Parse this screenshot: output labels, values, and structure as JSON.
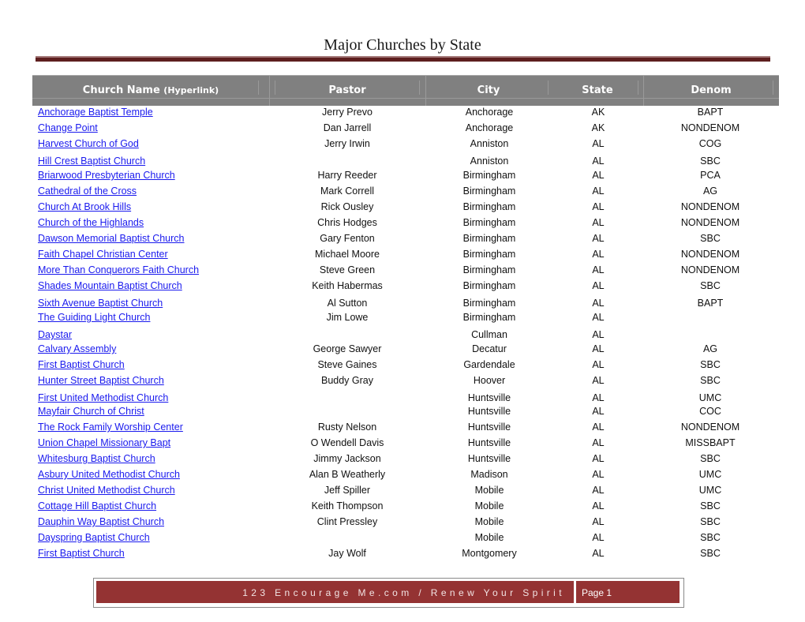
{
  "document": {
    "title": "Major Churches by State"
  },
  "table": {
    "headers": {
      "church_name": "Church Name",
      "church_name_note": "(Hyperlink)",
      "pastor": "Pastor",
      "city": "City",
      "state": "State",
      "denom": "Denom"
    },
    "rows": [
      {
        "name": "Anchorage Baptist Temple",
        "pastor": "Jerry Prevo",
        "city": "Anchorage",
        "state": "AK",
        "denom": "BAPT"
      },
      {
        "name": "Change Point",
        "pastor": "Dan Jarrell",
        "city": "Anchorage",
        "state": "AK",
        "denom": "NONDENOM"
      },
      {
        "name": "Harvest Church of God",
        "pastor": "Jerry Irwin",
        "city": "Anniston",
        "state": "AL",
        "denom": "COG"
      },
      {
        "name": "Hill Crest Baptist Church",
        "pastor": "",
        "city": "Anniston",
        "state": "AL",
        "denom": "SBC"
      },
      {
        "name": "Briarwood Presbyterian Church",
        "pastor": "Harry Reeder",
        "city": "Birmingham",
        "state": "AL",
        "denom": "PCA"
      },
      {
        "name": "Cathedral of the Cross",
        "pastor": "Mark Correll",
        "city": "Birmingham",
        "state": "AL",
        "denom": "AG"
      },
      {
        "name": "Church At Brook Hills",
        "pastor": "Rick Ousley",
        "city": "Birmingham",
        "state": "AL",
        "denom": "NONDENOM"
      },
      {
        "name": "Church of the Highlands",
        "pastor": "Chris Hodges",
        "city": "Birmingham",
        "state": "AL",
        "denom": "NONDENOM"
      },
      {
        "name": "Dawson Memorial Baptist Church",
        "pastor": "Gary Fenton",
        "city": "Birmingham",
        "state": "AL",
        "denom": "SBC"
      },
      {
        "name": "Faith Chapel Christian Center",
        "pastor": "Michael Moore",
        "city": "Birmingham",
        "state": "AL",
        "denom": "NONDENOM"
      },
      {
        "name": "More Than Conquerors Faith Church",
        "pastor": "Steve Green",
        "city": "Birmingham",
        "state": "AL",
        "denom": "NONDENOM"
      },
      {
        "name": "Shades Mountain Baptist Church",
        "pastor": "Keith Habermas",
        "city": "Birmingham",
        "state": "AL",
        "denom": "SBC"
      },
      {
        "name": "Sixth Avenue Baptist Church",
        "pastor": "Al Sutton",
        "city": "Birmingham",
        "state": "AL",
        "denom": "BAPT"
      },
      {
        "name": "The Guiding Light Church",
        "pastor": "Jim Lowe",
        "city": "Birmingham",
        "state": "AL",
        "denom": ""
      },
      {
        "name": "Daystar",
        "pastor": "",
        "city": "Cullman",
        "state": "AL",
        "denom": ""
      },
      {
        "name": "Calvary Assembly",
        "pastor": "George Sawyer",
        "city": "Decatur",
        "state": "AL",
        "denom": "AG"
      },
      {
        "name": "First Baptist Church",
        "pastor": "Steve Gaines",
        "city": "Gardendale",
        "state": "AL",
        "denom": "SBC"
      },
      {
        "name": "Hunter Street Baptist Church",
        "pastor": "Buddy Gray",
        "city": "Hoover",
        "state": "AL",
        "denom": "SBC"
      },
      {
        "name": "First United Methodist Church",
        "pastor": "",
        "city": "Huntsville",
        "state": "AL",
        "denom": "UMC"
      },
      {
        "name": "Mayfair Church of Christ",
        "pastor": "",
        "city": "Huntsville",
        "state": "AL",
        "denom": "COC"
      },
      {
        "name": "The Rock Family Worship Center",
        "pastor": "Rusty Nelson",
        "city": "Huntsville",
        "state": "AL",
        "denom": "NONDENOM"
      },
      {
        "name": "Union Chapel Missionary Bapt",
        "pastor": "O Wendell Davis",
        "city": "Huntsville",
        "state": "AL",
        "denom": "MISSBAPT"
      },
      {
        "name": "Whitesburg Baptist Church",
        "pastor": "Jimmy Jackson",
        "city": "Huntsville",
        "state": "AL",
        "denom": "SBC"
      },
      {
        "name": "Asbury United Methodist Church",
        "pastor": "Alan B Weatherly",
        "city": "Madison",
        "state": "AL",
        "denom": "UMC"
      },
      {
        "name": "Christ United Methodist Church",
        "pastor": "Jeff Spiller",
        "city": "Mobile",
        "state": "AL",
        "denom": "UMC"
      },
      {
        "name": "Cottage Hill Baptist Church",
        "pastor": "Keith Thompson",
        "city": "Mobile",
        "state": "AL",
        "denom": "SBC"
      },
      {
        "name": "Dauphin Way Baptist Church",
        "pastor": "Clint Pressley",
        "city": "Mobile",
        "state": "AL",
        "denom": "SBC"
      },
      {
        "name": "Dayspring Baptist Church",
        "pastor": "",
        "city": "Mobile",
        "state": "AL",
        "denom": "SBC"
      },
      {
        "name": "First Baptist Church",
        "pastor": "Jay Wolf",
        "city": "Montgomery",
        "state": "AL",
        "denom": "SBC"
      }
    ]
  },
  "footer": {
    "tagline": "123 Encourage Me.com / Renew Your Spirit",
    "page_label": "Page 1"
  },
  "colors": {
    "link": "#1a1aee",
    "header_bg": "#808080",
    "footer_bg": "#943333",
    "rule_dark": "#5e1f1f"
  }
}
